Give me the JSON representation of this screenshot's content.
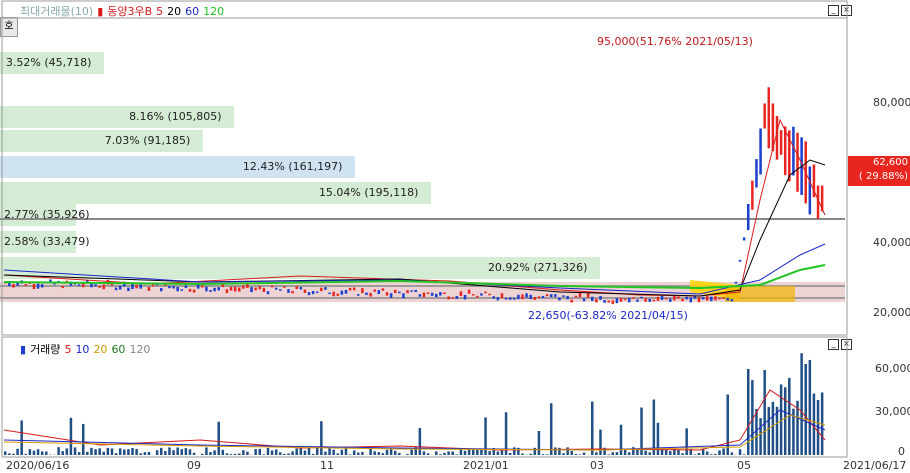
{
  "legend": {
    "prefix": "최대거래물(10)",
    "ticker": "동양3우B",
    "ma": [
      {
        "label": "5",
        "color": "#d81b1b"
      },
      {
        "label": "20",
        "color": "#000000"
      },
      {
        "label": "60",
        "color": "#1a27c9"
      },
      {
        "label": "120",
        "color": "#22c522"
      }
    ]
  },
  "volume_legend": {
    "title": "거래량",
    "ma": [
      {
        "label": "5",
        "color": "#d81b1b"
      },
      {
        "label": "10",
        "color": "#1a27c9"
      },
      {
        "label": "20",
        "color": "#d89a00"
      },
      {
        "label": "60",
        "color": "#1e7a1e"
      },
      {
        "label": "120",
        "color": "#888888"
      }
    ]
  },
  "sidebar_tab": "호",
  "volume_profile": [
    {
      "label": "3.52% (45,718)",
      "fraction": 0.123,
      "highlight": false
    },
    {
      "label": "8.16% (105,805)",
      "fraction": 0.277,
      "highlight": false
    },
    {
      "label": "7.03% (91,185)",
      "fraction": 0.24,
      "highlight": false
    },
    {
      "label": "12.43% (161,197)",
      "fraction": 0.42,
      "highlight": true
    },
    {
      "label": "15.04% (195,118)",
      "fraction": 0.51,
      "highlight": false
    },
    {
      "label": "2.77% (35,926)",
      "fraction": 0.09,
      "highlight": false
    },
    {
      "label": "2.58% (33,479)",
      "fraction": 0.09,
      "highlight": false
    },
    {
      "label": "20.92% (271,326)",
      "fraction": 0.71,
      "highlight": false
    }
  ],
  "annotations": {
    "high": "95,000(51.76% 2021/05/13)",
    "low": "22,650(-63.82% 2021/04/15)"
  },
  "current_price": {
    "value": "62,600",
    "change": "( 29.88%)"
  },
  "price_axis": [
    "80,000",
    "40,000",
    "20,000"
  ],
  "volume_axis": [
    "60,000",
    "30,000",
    "0"
  ],
  "date_axis": [
    "2020/06/16",
    "09",
    "11",
    "2021/01",
    "03",
    "05",
    "2021/06/17"
  ],
  "colors": {
    "up": "#e8261f",
    "down": "#1a3fd1",
    "vp_bar": "#d4ebd4",
    "vp_highlight": "#cfe3f1"
  }
}
